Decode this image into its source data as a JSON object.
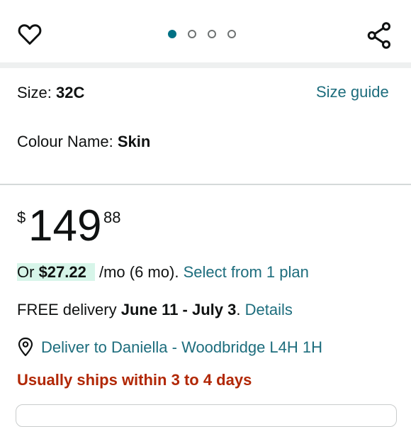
{
  "header": {
    "icons": {
      "favorite": "heart-outline-icon",
      "share": "share-icon"
    },
    "carousel": {
      "count": 4,
      "active_index": 0
    }
  },
  "size": {
    "label": "Size:",
    "value": "32C",
    "guide_link": "Size guide"
  },
  "colour": {
    "label": "Colour Name:",
    "value": "Skin"
  },
  "price": {
    "currency": "$",
    "whole": "149",
    "fraction": "88"
  },
  "installment": {
    "prefix": "Or ",
    "amount": "$27.22",
    "suffix": " /mo (6 mo).",
    "link": "Select from 1 plan"
  },
  "delivery": {
    "prefix": "FREE delivery ",
    "dates": "June 11 - July 3",
    "period": ".",
    "details_link": "Details"
  },
  "location": {
    "text": "Deliver to Daniella - Woodbridge L4H 1H"
  },
  "availability": {
    "text": "Usually ships within 3 to 4 days"
  },
  "colors": {
    "link": "#1d6d7d",
    "warning": "#b12704",
    "accent": "#007185",
    "pill": "#d7f5e9"
  }
}
